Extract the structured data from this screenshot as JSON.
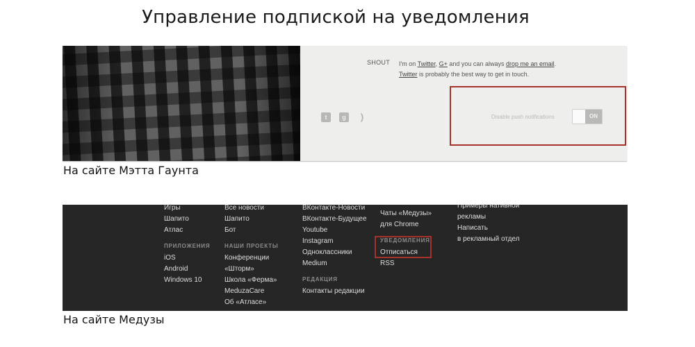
{
  "title": "Управление подпиской на уведомления",
  "example1": {
    "shout_label": "SHOUT",
    "shout_line1": {
      "prefix": "I'm on",
      "twitter": "Twitter",
      "comma": ",",
      "gplus": "G+",
      "middle": "and you can always",
      "email": "drop me an email",
      "end": "."
    },
    "shout_line2": {
      "twitter": "Twitter",
      "rest": "is probably the best way to get in touch."
    },
    "social_icons": [
      "twitter-icon",
      "google-plus-icon",
      "rss-icon"
    ],
    "push_label": "Disable push notifications",
    "toggle_state": "ON",
    "caption": "На сайте Мэтта Гаунта"
  },
  "example2": {
    "columns": [
      {
        "items": [
          "Игры",
          "Шапито",
          "Атлас"
        ],
        "heading": "ПРИЛОЖЕНИЯ",
        "items2": [
          "iOS",
          "Android",
          "Windows 10"
        ]
      },
      {
        "items": [
          "Все новости",
          "Шапито",
          "Бот"
        ],
        "heading": "НАШИ ПРОЕКТЫ",
        "items2": [
          "Конференции",
          "«Шторм»",
          "Школа «Ферма»",
          "MeduzaCare",
          "Об «Атласе»"
        ]
      },
      {
        "items": [
          "ВКонтакте-Новости",
          "ВКонтакте-Будущее",
          "Youtube",
          "Instagram",
          "Одноклассники",
          "Medium"
        ],
        "heading": "РЕДАКЦИЯ",
        "items2": [
          "Контакты редакции"
        ]
      },
      {
        "items": [
          "Чаты «Медузы»",
          "для Chrome"
        ],
        "heading": "УВЕДОМЛЕНИЯ",
        "items2": [
          "Отписаться",
          "RSS"
        ]
      },
      {
        "items": [
          "Примеры нативной",
          "рекламы",
          "Написать",
          "в рекламный отдел"
        ]
      }
    ],
    "caption": "На сайте Медузы"
  }
}
